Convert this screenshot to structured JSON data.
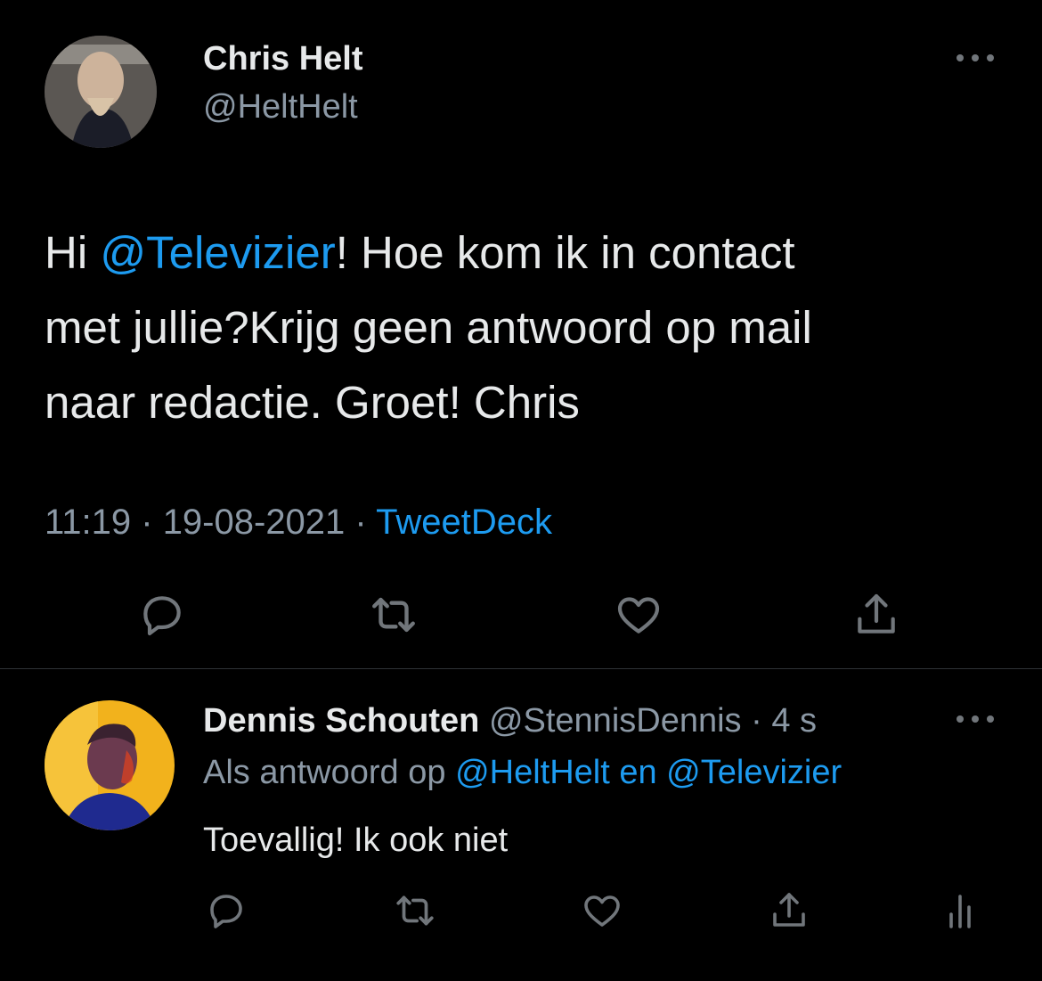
{
  "main_tweet": {
    "author_name": "Chris Helt",
    "author_handle": "@HeltHelt",
    "text_part1": "Hi ",
    "mention": "@Televizier",
    "text_part2": "! Hoe kom ik in contact",
    "text_line2": "met jullie?Krijg geen antwoord op mail",
    "text_line3": "naar redactie. Groet! Chris",
    "time": "11:19",
    "sep1": " · ",
    "date": "19-08-2021",
    "sep2": " · ",
    "source": "TweetDeck",
    "icons": [
      "reply-icon",
      "retweet-icon",
      "like-icon",
      "share-icon"
    ]
  },
  "reply_tweet": {
    "author_name": "Dennis Schouten",
    "author_handle": "@StennisDennis",
    "age": "· 4 s",
    "reply_prefix": "Als antwoord op ",
    "reply_mentions": "@HeltHelt en @Televizier",
    "text": "Toevallig! Ik ook niet",
    "icons": [
      "reply-icon",
      "retweet-icon",
      "like-icon",
      "share-icon",
      "analytics-icon"
    ]
  },
  "colors": {
    "background": "#000000",
    "text": "#e7e9ea",
    "muted": "#71767b",
    "accent": "#1d9bf0",
    "divider": "#2f3336"
  }
}
